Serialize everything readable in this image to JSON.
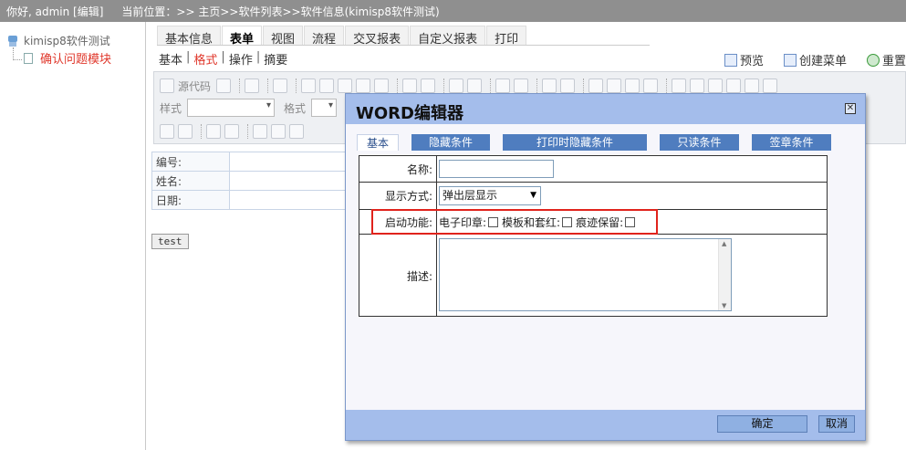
{
  "topbar": {
    "greeting": "你好, admin [编辑]",
    "location": "当前位置：>> 主页>>软件列表>>软件信息(kimisp8软件测试)"
  },
  "tree": {
    "root": "kimisp8软件测试",
    "child": "确认问题模块"
  },
  "tabs": [
    "基本信息",
    "表单",
    "视图",
    "流程",
    "交叉报表",
    "自定义报表",
    "打印"
  ],
  "active_tab": "表单",
  "subtabs": [
    "基本",
    "格式",
    "操作",
    "摘要"
  ],
  "active_subtab": "格式",
  "actions": {
    "preview": "预览",
    "create_menu": "创建菜单",
    "reset": "重置"
  },
  "toolbar": {
    "source": "源代码",
    "style_label": "样式",
    "format_label": "格式"
  },
  "form": {
    "rows": [
      "编号:",
      "姓名:",
      "日期:"
    ],
    "test_button": "test"
  },
  "dialog": {
    "title": "WORD编辑器",
    "tabs": [
      "基本",
      "隐藏条件",
      "打印时隐藏条件",
      "只读条件",
      "签章条件"
    ],
    "name_label": "名称:",
    "name_value": "",
    "display_label": "显示方式:",
    "display_value": "弹出层显示",
    "enable_label": "启动功能:",
    "checkboxes": [
      "电子印章:",
      "模板和套红:",
      "痕迹保留:"
    ],
    "desc_label": "描述:",
    "ok_button": "确定",
    "cancel_button": "取消"
  },
  "colors": {
    "dialog_header": "#a4bdeb",
    "tab_blue": "#4f7dbf",
    "highlight_red": "#e0231c",
    "active_red": "#e0382c"
  }
}
